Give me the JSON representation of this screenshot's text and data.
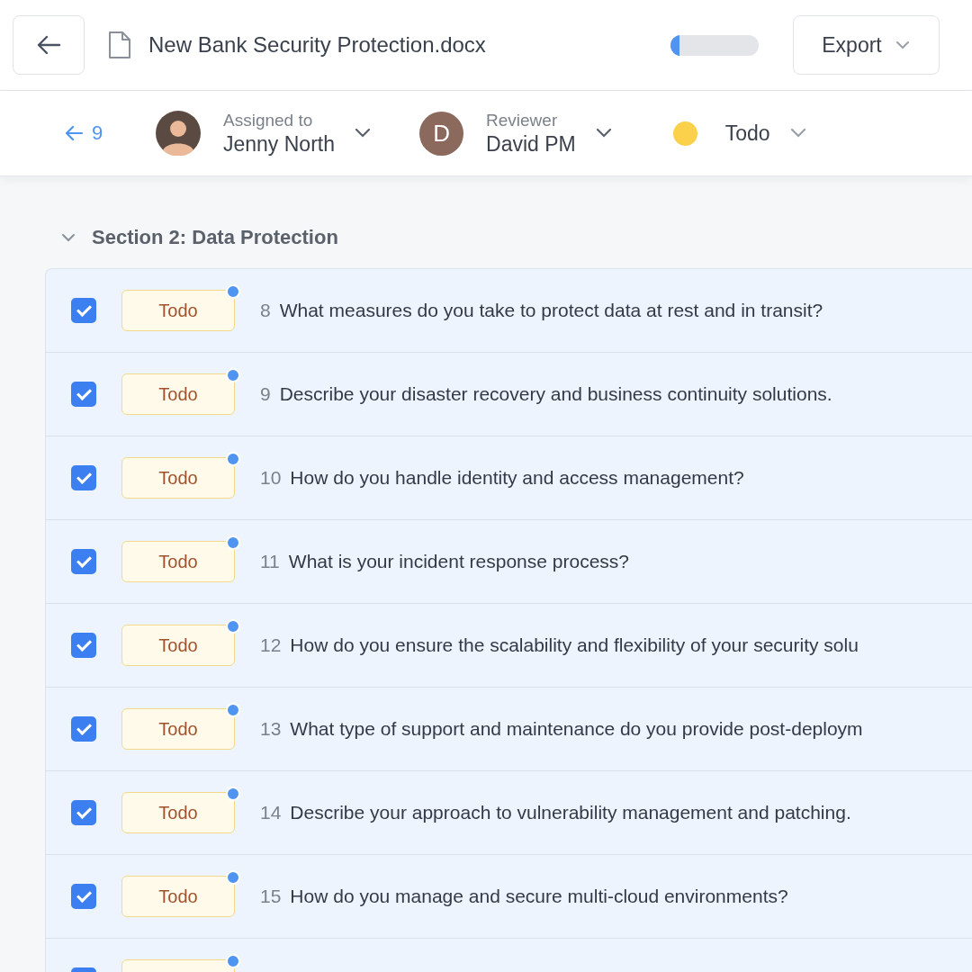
{
  "header": {
    "file_name": "New Bank Security Protection.docx",
    "progress": {
      "level": 0.1
    },
    "export_button": "Export"
  },
  "toolbar": {
    "back_count": "9",
    "assignee": {
      "label": "Assigned to",
      "name": "Jenny North"
    },
    "reviewer": {
      "label": "Reviewer",
      "initial": "D",
      "name": "David PM"
    },
    "status": {
      "label": "Todo",
      "color": "#fbd14b"
    }
  },
  "section": {
    "title": "Section 2: Data Protection",
    "expanded": true,
    "questions": [
      {
        "checked": true,
        "status": "Todo",
        "unread": true,
        "number": "8",
        "text": "What measures do you take to protect data at rest and in transit?"
      },
      {
        "checked": true,
        "status": "Todo",
        "unread": true,
        "number": "9",
        "text": "Describe your disaster recovery and business continuity solutions."
      },
      {
        "checked": true,
        "status": "Todo",
        "unread": true,
        "number": "10",
        "text": "How do you handle identity and access management?"
      },
      {
        "checked": true,
        "status": "Todo",
        "unread": true,
        "number": "11",
        "text": "What is your incident response process?"
      },
      {
        "checked": true,
        "status": "Todo",
        "unread": true,
        "number": "12",
        "text": "How do you ensure the scalability and flexibility of your security solu"
      },
      {
        "checked": true,
        "status": "Todo",
        "unread": true,
        "number": "13",
        "text": "What type of support and maintenance do you provide post-deploym"
      },
      {
        "checked": true,
        "status": "Todo",
        "unread": true,
        "number": "14",
        "text": "Describe your approach to vulnerability management and patching."
      },
      {
        "checked": true,
        "status": "Todo",
        "unread": true,
        "number": "15",
        "text": "How do you manage and secure multi-cloud environments?"
      },
      {
        "checked": true,
        "unread": true
      }
    ]
  }
}
